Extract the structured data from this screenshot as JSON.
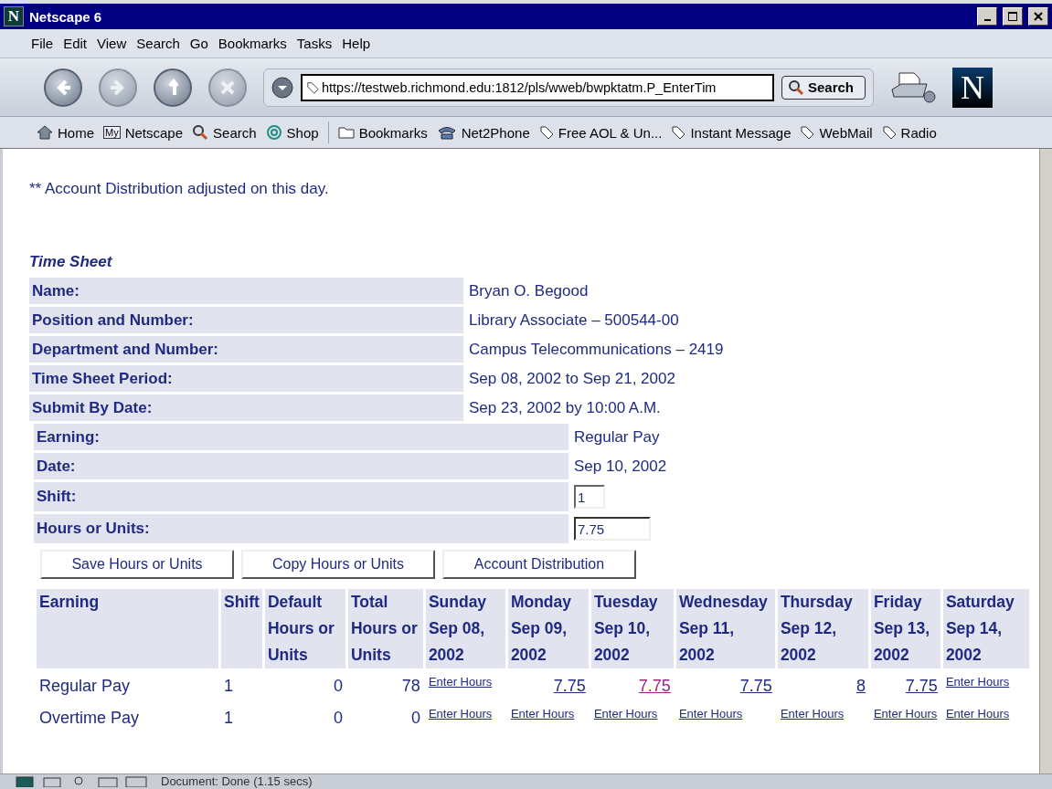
{
  "window": {
    "logo": "N",
    "title": "Netscape 6"
  },
  "menu": [
    "File",
    "Edit",
    "View",
    "Search",
    "Go",
    "Bookmarks",
    "Tasks",
    "Help"
  ],
  "nav": {
    "url": "https://testweb.richmond.edu:1812/pls/wweb/bwpktatm.P_EnterTim",
    "search_button": "Search",
    "brand": "N"
  },
  "personal_toolbar": [
    {
      "kind": "home",
      "label": "Home"
    },
    {
      "kind": "my",
      "badge": "My",
      "label": "Netscape"
    },
    {
      "kind": "search",
      "label": "Search"
    },
    {
      "kind": "shop",
      "label": "Shop"
    },
    {
      "kind": "folder",
      "label": "Bookmarks"
    },
    {
      "kind": "phone",
      "label": "Net2Phone"
    },
    {
      "kind": "tag",
      "label": "Free AOL & Un..."
    },
    {
      "kind": "tag",
      "label": "Instant Message"
    },
    {
      "kind": "tag",
      "label": "WebMail"
    },
    {
      "kind": "tag",
      "label": "Radio"
    }
  ],
  "note": "** Account Distribution adjusted on this day.",
  "time_sheet": {
    "title": "Time Sheet",
    "rows": [
      {
        "label": "Name:",
        "value": "Bryan O. Begood"
      },
      {
        "label": "Position and Number:",
        "value": "Library Associate – 500544-00"
      },
      {
        "label": "Department and Number:",
        "value": "Campus Telecommunications – 2419"
      },
      {
        "label": "Time Sheet Period:",
        "value": "Sep 08, 2002 to Sep 21, 2002"
      },
      {
        "label": "Submit By Date:",
        "value": "Sep 23, 2002 by 10:00 A.M."
      }
    ]
  },
  "entry": {
    "rows": [
      {
        "kind": "text",
        "label": "Earning:",
        "value": "Regular Pay"
      },
      {
        "kind": "text",
        "label": "Date:",
        "value": "Sep 10, 2002"
      },
      {
        "kind": "input",
        "label": "Shift:",
        "value": "1"
      },
      {
        "kind": "input",
        "label": "Hours or Units:",
        "value": "7.75",
        "focused": true
      }
    ],
    "buttons": [
      "Save Hours or Units",
      "Copy Hours or Units",
      "Account Distribution"
    ]
  },
  "grid": {
    "columns": [
      "Earning",
      "Shift",
      "Default Hours or Units",
      "Total Hours or Units",
      "Sunday Sep 08, 2002",
      "Monday Sep 09, 2002",
      "Tuesday Sep 10, 2002",
      "Wednesday Sep 11, 2002",
      "Thursday Sep 12, 2002",
      "Friday Sep 13, 2002",
      "Saturday Sep 14, 2002"
    ],
    "rows": [
      {
        "earning": "Regular Pay",
        "shift": "1",
        "default": "0",
        "total": "78",
        "days": [
          {
            "kind": "enter",
            "text": "Enter Hours",
            "visited": false
          },
          {
            "kind": "hours",
            "text": "7.75",
            "visited": false
          },
          {
            "kind": "hours",
            "text": "7.75",
            "visited": true
          },
          {
            "kind": "hours",
            "text": "7.75",
            "visited": false
          },
          {
            "kind": "hours",
            "text": "8",
            "visited": false
          },
          {
            "kind": "hours",
            "text": "7.75",
            "visited": false
          },
          {
            "kind": "enter",
            "text": "Enter Hours",
            "visited": false
          }
        ]
      },
      {
        "earning": "Overtime Pay",
        "shift": "1",
        "default": "0",
        "total": "0",
        "days": [
          {
            "kind": "enter",
            "text": "Enter Hours",
            "visited": false
          },
          {
            "kind": "enter",
            "text": "Enter Hours",
            "visited": false
          },
          {
            "kind": "enter",
            "text": "Enter Hours",
            "visited": false
          },
          {
            "kind": "enter",
            "text": "Enter Hours",
            "visited": false
          },
          {
            "kind": "enter",
            "text": "Enter Hours",
            "visited": false
          },
          {
            "kind": "enter",
            "text": "Enter Hours",
            "visited": false
          },
          {
            "kind": "enter",
            "text": "Enter Hours",
            "visited": false
          }
        ]
      }
    ]
  },
  "status_bar": {
    "text": "Document: Done (1.15 secs)"
  }
}
